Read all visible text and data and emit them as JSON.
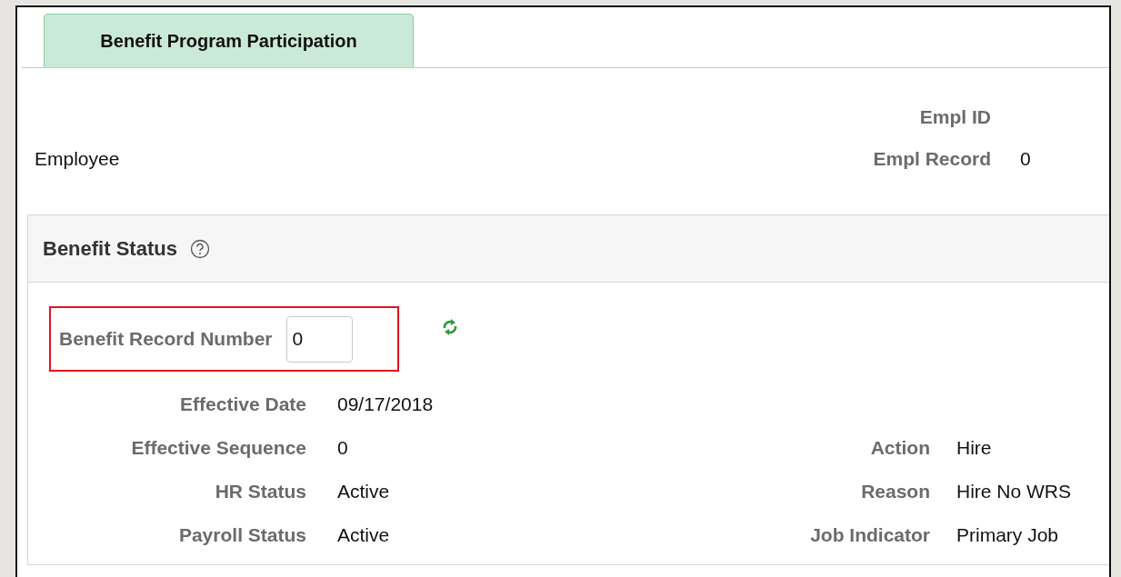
{
  "tab": {
    "label": "Benefit Program Participation",
    "selected": true
  },
  "header": {
    "employee_label": "Employee",
    "empl_id": {
      "label": "Empl ID"
    },
    "empl_record": {
      "label": "Empl Record",
      "value": "0"
    }
  },
  "section": {
    "title": "Benefit Status",
    "benefit_record": {
      "label": "Benefit Record Number",
      "value": "0",
      "highlighted": true
    },
    "rows": [
      {
        "left": {
          "label": "Effective Date",
          "value": "09/17/2018"
        }
      },
      {
        "left": {
          "label": "Effective Sequence",
          "value": "0"
        },
        "right": {
          "label": "Action",
          "value": "Hire"
        }
      },
      {
        "left": {
          "label": "HR Status",
          "value": "Active"
        },
        "right": {
          "label": "Reason",
          "value": "Hire No WRS"
        }
      },
      {
        "left": {
          "label": "Payroll Status",
          "value": "Active"
        },
        "right": {
          "label": "Job Indicator",
          "value": "Primary Job"
        }
      }
    ]
  }
}
